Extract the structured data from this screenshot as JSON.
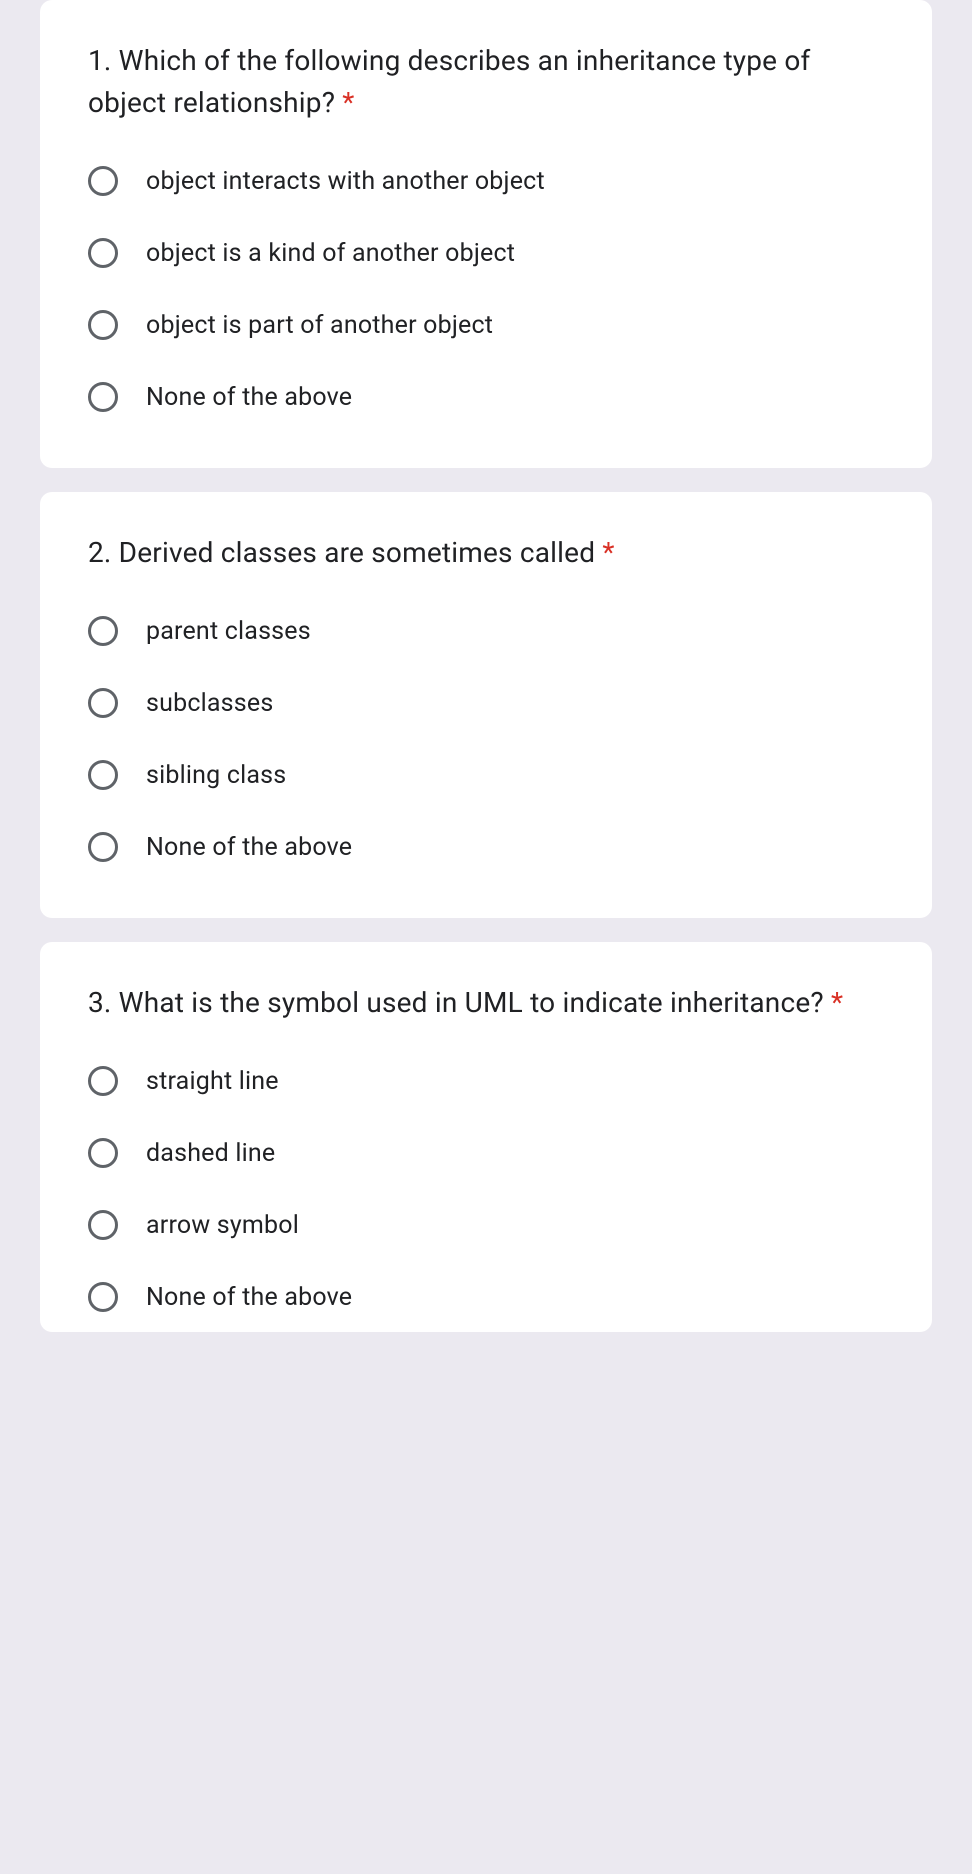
{
  "questions": [
    {
      "title_prefix": "1. ",
      "title": "Which of the following describes an inheritance type of object relationship?",
      "required": true,
      "options": [
        "object interacts with another object",
        "object is a kind of another object",
        "object is part of another object",
        "None of the above"
      ]
    },
    {
      "title_prefix": "2. ",
      "title": "Derived classes are sometimes called",
      "required": true,
      "options": [
        "parent classes",
        "subclasses",
        "sibling class",
        "None of the above"
      ]
    },
    {
      "title_prefix": "3. ",
      "title": "What is the symbol used in UML to indicate inheritance?",
      "required": true,
      "options": [
        "straight line",
        "dashed line",
        "arrow symbol",
        "None of the above"
      ]
    }
  ],
  "asterisk": " *"
}
